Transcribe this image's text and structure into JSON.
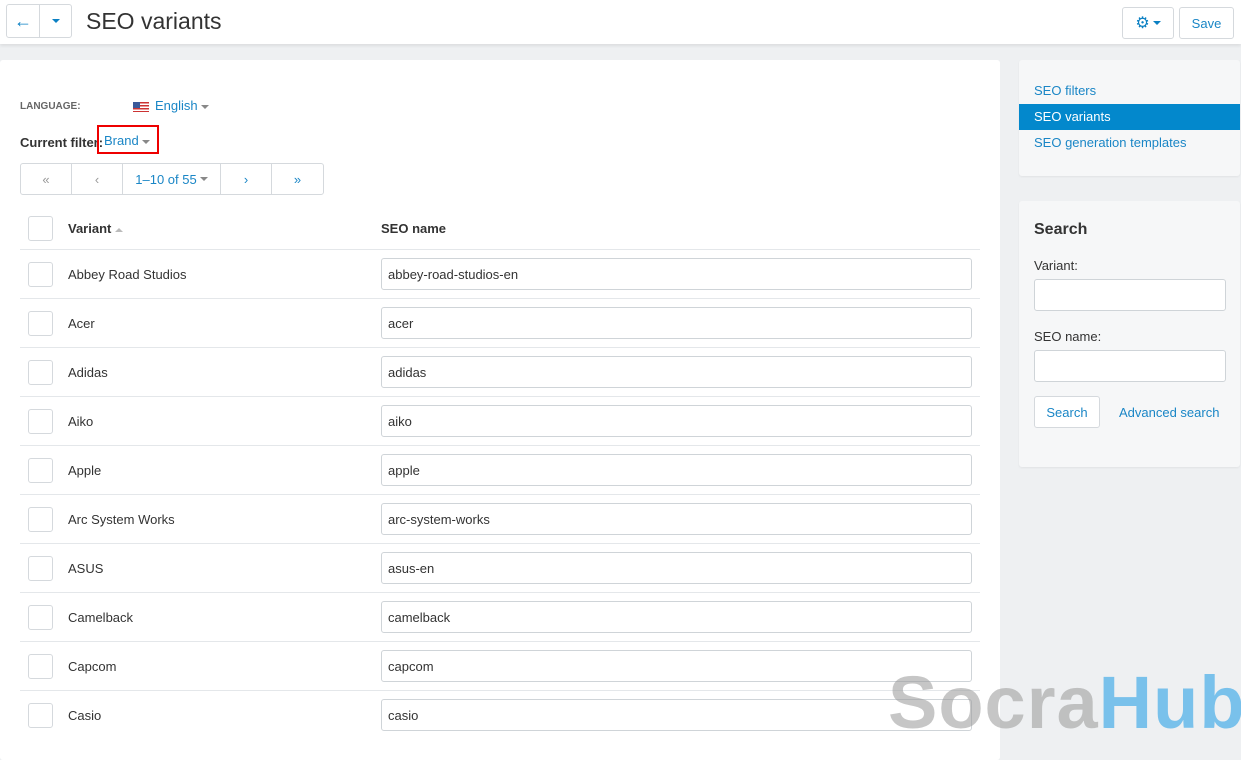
{
  "header": {
    "title": "SEO variants",
    "save_label": "Save"
  },
  "language": {
    "label": "LANGUAGE:",
    "value": "English"
  },
  "filter": {
    "label": "Current filter:",
    "value": "Brand"
  },
  "pager": {
    "first": "«",
    "prev": "‹",
    "range": "1–10 of 55",
    "next": "›",
    "last": "»"
  },
  "table": {
    "col_variant": "Variant",
    "col_seo": "SEO name",
    "rows": [
      {
        "name": "Abbey Road Studios",
        "seo": "abbey-road-studios-en"
      },
      {
        "name": "Acer",
        "seo": "acer"
      },
      {
        "name": "Adidas",
        "seo": "adidas"
      },
      {
        "name": "Aiko",
        "seo": "aiko"
      },
      {
        "name": "Apple",
        "seo": "apple"
      },
      {
        "name": "Arc System Works",
        "seo": "arc-system-works"
      },
      {
        "name": "ASUS",
        "seo": "asus-en"
      },
      {
        "name": "Camelback",
        "seo": "camelback"
      },
      {
        "name": "Capcom",
        "seo": "capcom"
      },
      {
        "name": "Casio",
        "seo": "casio"
      }
    ]
  },
  "sidebar": {
    "items": [
      {
        "label": "SEO filters"
      },
      {
        "label": "SEO variants"
      },
      {
        "label": "SEO generation templates"
      }
    ]
  },
  "search": {
    "title": "Search",
    "variant_label": "Variant:",
    "seo_label": "SEO name:",
    "search_button": "Search",
    "advanced": "Advanced search"
  },
  "watermark": {
    "part1": "Socra",
    "part2": "Hub"
  }
}
